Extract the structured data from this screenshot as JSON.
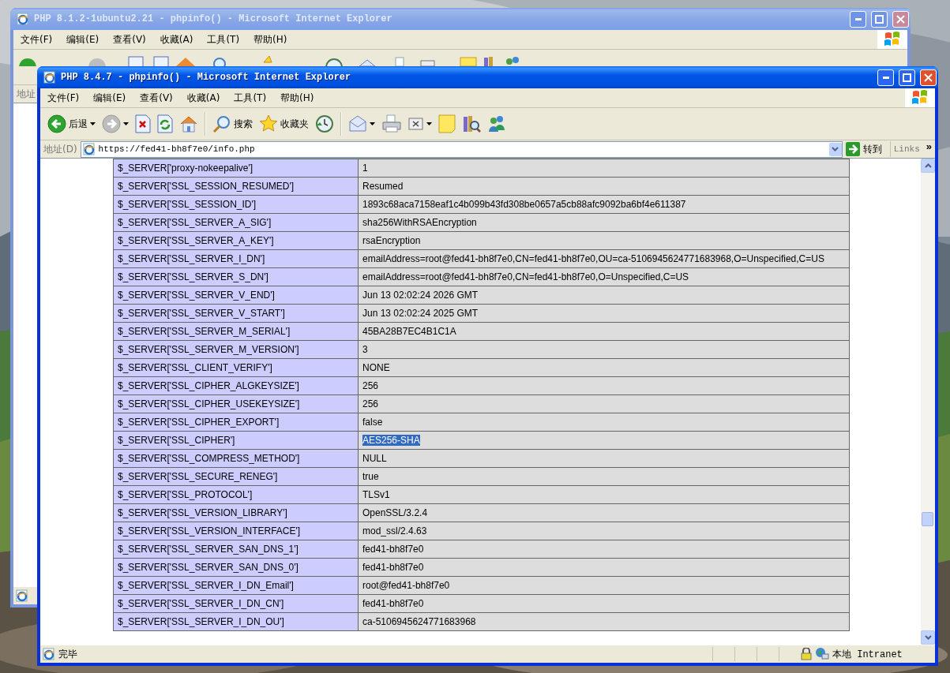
{
  "back_window": {
    "title": "PHP 8.1.2-1ubuntu2.21 - phpinfo() - Microsoft Internet Explorer",
    "active": false,
    "menu": [
      "文件(F)",
      "编辑(E)",
      "查看(V)",
      "收藏(A)",
      "工具(T)",
      "帮助(H)"
    ],
    "address_label": "地址"
  },
  "front_window": {
    "title": "PHP 8.4.7 - phpinfo() - Microsoft Internet Explorer",
    "active": true,
    "menu": [
      "文件(F)",
      "编辑(E)",
      "查看(V)",
      "收藏(A)",
      "工具(T)",
      "帮助(H)"
    ],
    "toolbar": [
      {
        "kind": "back",
        "label": "后退",
        "dropdown": true
      },
      {
        "kind": "forward",
        "dropdown": true
      },
      {
        "kind": "stop",
        "dropdown": false
      },
      {
        "kind": "refresh",
        "dropdown": false
      },
      {
        "kind": "home",
        "dropdown": false
      },
      {
        "kind": "separator"
      },
      {
        "kind": "search",
        "label": "搜索",
        "dropdown": false
      },
      {
        "kind": "favorites",
        "label": "收藏夹",
        "dropdown": false
      },
      {
        "kind": "history",
        "dropdown": false
      },
      {
        "kind": "separator"
      },
      {
        "kind": "mail",
        "dropdown": true
      },
      {
        "kind": "print",
        "dropdown": false
      },
      {
        "kind": "edit",
        "dropdown": true
      },
      {
        "kind": "note",
        "dropdown": false
      },
      {
        "kind": "research",
        "dropdown": false
      },
      {
        "kind": "messenger",
        "dropdown": false
      }
    ],
    "address": {
      "label": "地址(D)",
      "value": "https://fed41-bh8f7e0/info.php"
    },
    "go_button": "转到",
    "links": "Links",
    "links_chevron": "»",
    "table": {
      "rows": [
        {
          "name": "$_SERVER['proxy-nokeepalive']",
          "value": "1",
          "value_selected": false
        },
        {
          "name": "$_SERVER['SSL_SESSION_RESUMED']",
          "value": "Resumed",
          "value_selected": false
        },
        {
          "name": "$_SERVER['SSL_SESSION_ID']",
          "value": "1893c68aca7158eaf1c4b099b43fd308be0657a5cb88afc9092ba6bf4e611387",
          "value_selected": false
        },
        {
          "name": "$_SERVER['SSL_SERVER_A_SIG']",
          "value": "sha256WithRSAEncryption",
          "value_selected": false
        },
        {
          "name": "$_SERVER['SSL_SERVER_A_KEY']",
          "value": "rsaEncryption",
          "value_selected": false
        },
        {
          "name": "$_SERVER['SSL_SERVER_I_DN']",
          "value": "emailAddress=root@fed41-bh8f7e0,CN=fed41-bh8f7e0,OU=ca-5106945624771683968,O=Unspecified,C=US",
          "value_selected": false
        },
        {
          "name": "$_SERVER['SSL_SERVER_S_DN']",
          "value": "emailAddress=root@fed41-bh8f7e0,CN=fed41-bh8f7e0,O=Unspecified,C=US",
          "value_selected": false
        },
        {
          "name": "$_SERVER['SSL_SERVER_V_END']",
          "value": "Jun 13 02:02:24 2026 GMT",
          "value_selected": false
        },
        {
          "name": "$_SERVER['SSL_SERVER_V_START']",
          "value": "Jun 13 02:02:24 2025 GMT",
          "value_selected": false
        },
        {
          "name": "$_SERVER['SSL_SERVER_M_SERIAL']",
          "value": "45BA28B7EC4B1C1A",
          "value_selected": false
        },
        {
          "name": "$_SERVER['SSL_SERVER_M_VERSION']",
          "value": "3",
          "value_selected": false
        },
        {
          "name": "$_SERVER['SSL_CLIENT_VERIFY']",
          "value": "NONE",
          "value_selected": false
        },
        {
          "name": "$_SERVER['SSL_CIPHER_ALGKEYSIZE']",
          "value": "256",
          "value_selected": false
        },
        {
          "name": "$_SERVER['SSL_CIPHER_USEKEYSIZE']",
          "value": "256",
          "value_selected": false
        },
        {
          "name": "$_SERVER['SSL_CIPHER_EXPORT']",
          "value": "false",
          "value_selected": false
        },
        {
          "name": "$_SERVER['SSL_CIPHER']",
          "value": "AES256-SHA",
          "value_selected": true
        },
        {
          "name": "$_SERVER['SSL_COMPRESS_METHOD']",
          "value": "NULL",
          "value_selected": false
        },
        {
          "name": "$_SERVER['SSL_SECURE_RENEG']",
          "value": "true",
          "value_selected": false
        },
        {
          "name": "$_SERVER['SSL_PROTOCOL']",
          "value": "TLSv1",
          "value_selected": false
        },
        {
          "name": "$_SERVER['SSL_VERSION_LIBRARY']",
          "value": "OpenSSL/3.2.4",
          "value_selected": false
        },
        {
          "name": "$_SERVER['SSL_VERSION_INTERFACE']",
          "value": "mod_ssl/2.4.63",
          "value_selected": false
        },
        {
          "name": "$_SERVER['SSL_SERVER_SAN_DNS_1']",
          "value": "fed41-bh8f7e0",
          "value_selected": false
        },
        {
          "name": "$_SERVER['SSL_SERVER_SAN_DNS_0']",
          "value": "fed41-bh8f7e0",
          "value_selected": false
        },
        {
          "name": "$_SERVER['SSL_SERVER_I_DN_Email']",
          "value": "root@fed41-bh8f7e0",
          "value_selected": false
        },
        {
          "name": "$_SERVER['SSL_SERVER_I_DN_CN']",
          "value": "fed41-bh8f7e0",
          "value_selected": false
        },
        {
          "name": "$_SERVER['SSL_SERVER_I_DN_OU']",
          "value": "ca-5106945624771683968",
          "value_selected": false
        }
      ]
    },
    "status_bar": {
      "text": "完毕",
      "zone": "本地 Intranet"
    }
  }
}
